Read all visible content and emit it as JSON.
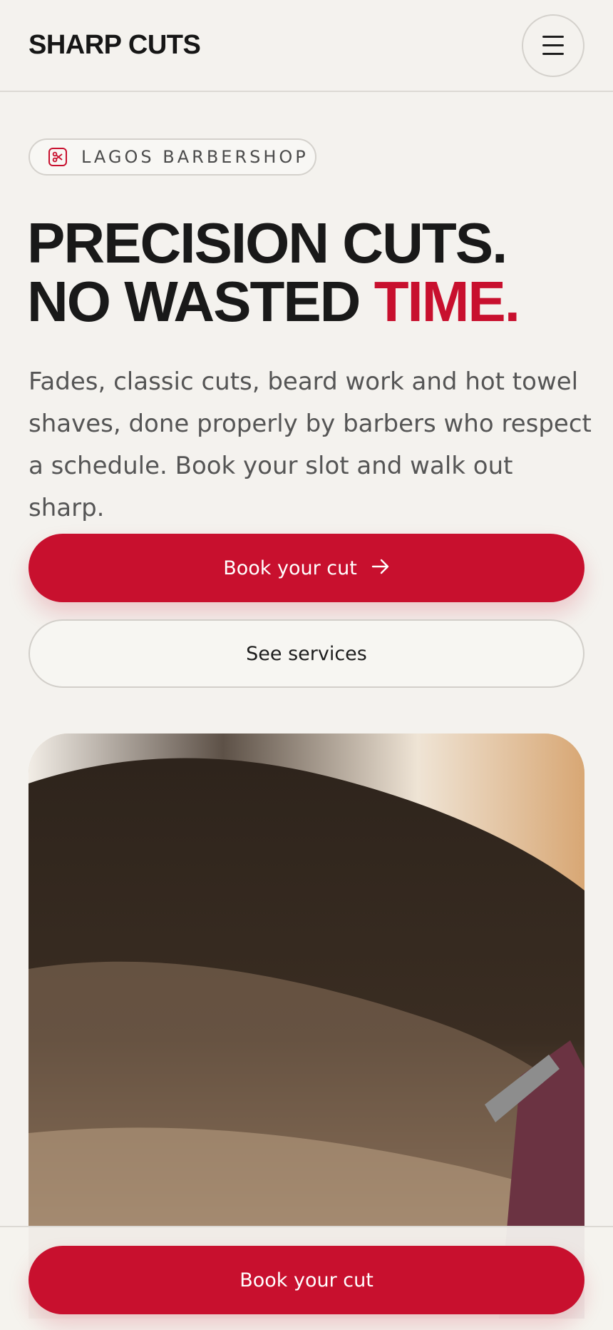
{
  "header": {
    "brand": "SHARP CUTS",
    "menu_icon": "hamburger-menu-icon"
  },
  "badge": {
    "icon": "scissors-icon",
    "text": "LAGOS BARBERSHOP"
  },
  "hero": {
    "headline_line1": "PRECISION CUTS.",
    "headline_line2_prefix": "NO WASTED ",
    "headline_line2_accent": "TIME.",
    "lede": "Fades, classic cuts, beard work and hot towel shaves, done properly by barbers who respect a schedule. Book your slot and walk out sharp."
  },
  "actions": {
    "primary_label": "Book your cut",
    "primary_icon": "arrow-right-icon",
    "secondary_label": "See services"
  },
  "sticky": {
    "label": "Book your cut"
  },
  "colors": {
    "accent": "#c8102e",
    "background": "#f4f2ee",
    "text": "#1b1b1b"
  }
}
